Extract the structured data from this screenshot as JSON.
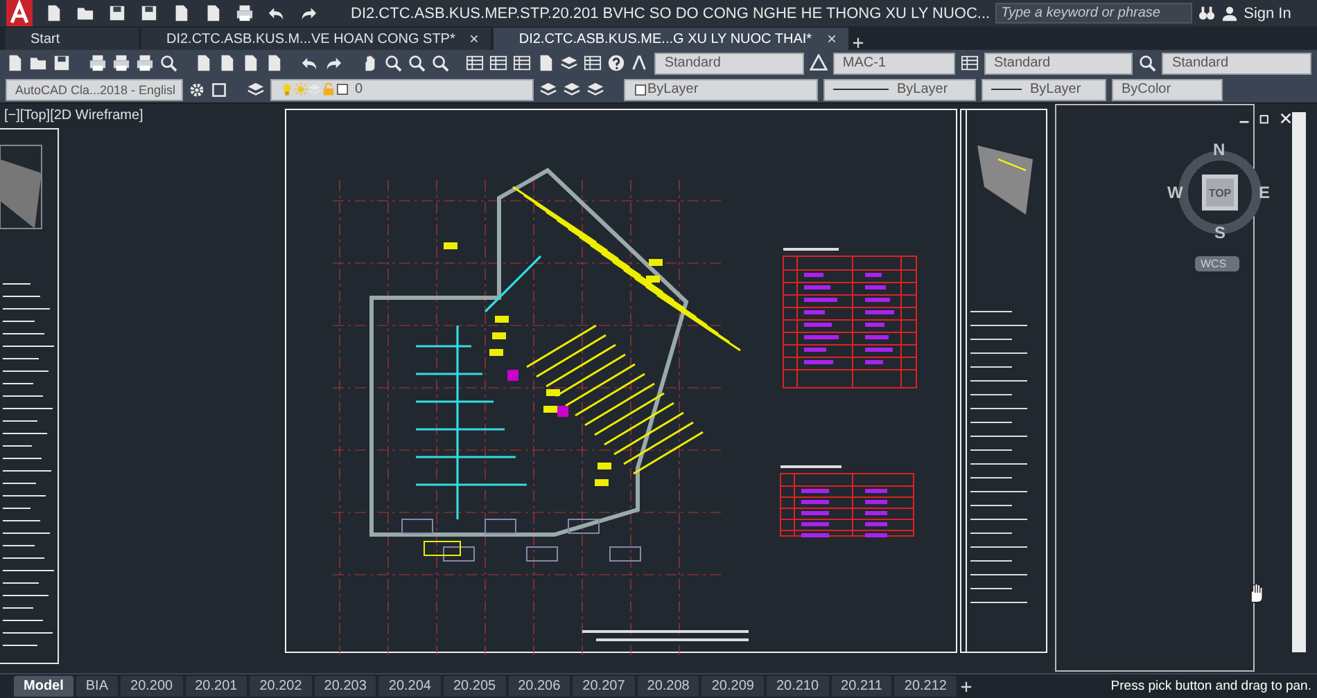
{
  "title_bar": {
    "title": "DI2.CTC.ASB.KUS.MEP.STP.20.201 BVHC SO DO CONG NGHE HE THONG XU LY NUOC...",
    "search": {
      "placeholder": "Type a keyword or phrase"
    },
    "sign_in": "Sign In"
  },
  "file_tabs": [
    {
      "label": "Start",
      "selected": false
    },
    {
      "label": "DI2.CTC.ASB.KUS.M...VE HOAN CONG STP*",
      "selected": false
    },
    {
      "label": "DI2.CTC.ASB.KUS.ME...G XU LY NUOC THAI*",
      "selected": true
    }
  ],
  "toolbar": {
    "styles": [
      "Standard",
      "MAC-1",
      "Standard",
      "Standard"
    ],
    "workspace": "AutoCAD Cla...2018 - Englisl",
    "layer": "0",
    "properties": [
      "ByLayer",
      "ByLayer",
      "ByLayer",
      "ByColor"
    ]
  },
  "viewport": {
    "label": "[−][Top][2D Wireframe]",
    "viewcube": {
      "face": "TOP",
      "north": "N",
      "south": "S",
      "east": "E",
      "west": "W",
      "ucs": "WCS"
    }
  },
  "layout_tabs": [
    {
      "label": "Model",
      "selected": true
    },
    {
      "label": "BIA",
      "selected": false
    },
    {
      "label": "20.200",
      "selected": false
    },
    {
      "label": "20.201",
      "selected": false
    },
    {
      "label": "20.202",
      "selected": false
    },
    {
      "label": "20.203",
      "selected": false
    },
    {
      "label": "20.204",
      "selected": false
    },
    {
      "label": "20.205",
      "selected": false
    },
    {
      "label": "20.206",
      "selected": false
    },
    {
      "label": "20.207",
      "selected": false
    },
    {
      "label": "20.208",
      "selected": false
    },
    {
      "label": "20.209",
      "selected": false
    },
    {
      "label": "20.210",
      "selected": false
    },
    {
      "label": "20.211",
      "selected": false
    },
    {
      "label": "20.212",
      "selected": false
    }
  ],
  "status": "Press pick button and drag to pan."
}
